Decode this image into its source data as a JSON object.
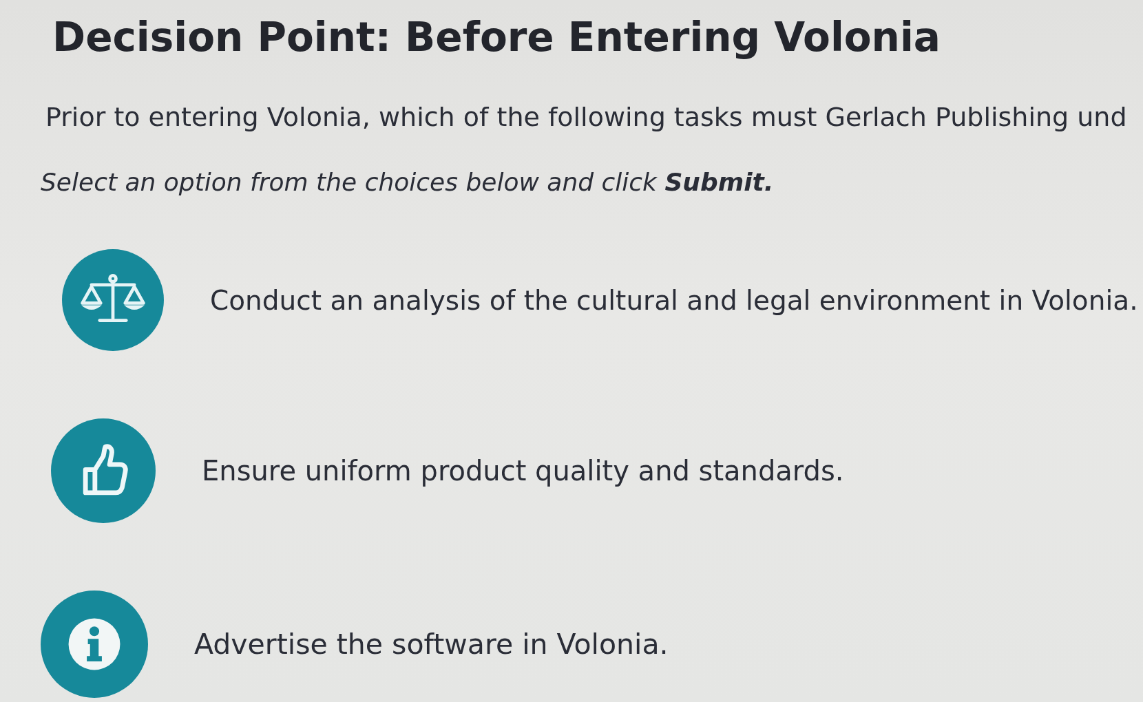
{
  "title": "Decision Point: Before Entering Volonia",
  "question": "Prior to entering Volonia, which of the following tasks must Gerlach Publishing und",
  "instruction": "Select an option from the choices below and click **Submit.**",
  "options": [
    {
      "label": "Conduct an analysis of the cultural and legal environment in Volonia."
    },
    {
      "label": "Ensure uniform product quality and standards."
    },
    {
      "label": "Advertise the software in Volonia."
    }
  ]
}
